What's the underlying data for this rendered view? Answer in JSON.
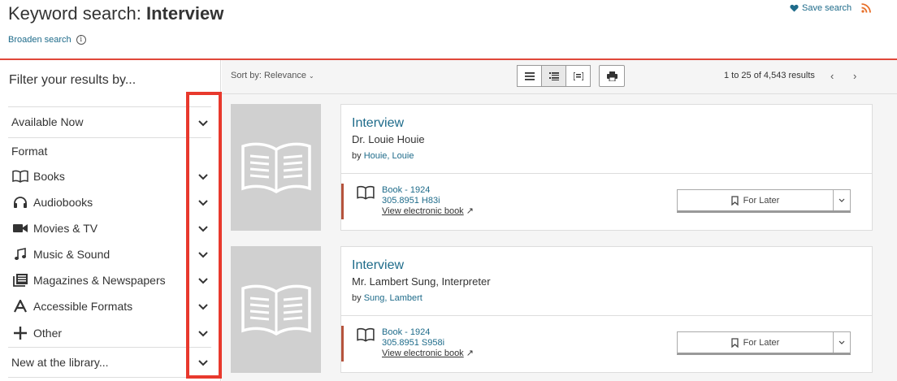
{
  "header": {
    "title_prefix": "Keyword search: ",
    "query": "Interview",
    "broaden": "Broaden search",
    "info_glyph": "i",
    "save_search": "Save search"
  },
  "sidebar": {
    "filter_title": "Filter your results by...",
    "available_now": "Available Now",
    "format_heading": "Format",
    "formats": [
      {
        "label": "Books",
        "icon": "book-icon"
      },
      {
        "label": "Audiobooks",
        "icon": "headphones-icon"
      },
      {
        "label": "Movies & TV",
        "icon": "video-camera-icon"
      },
      {
        "label": "Music & Sound",
        "icon": "music-note-icon"
      },
      {
        "label": "Magazines & Newspapers",
        "icon": "magazine-icon"
      },
      {
        "label": "Accessible Formats",
        "icon": "letter-a-icon"
      },
      {
        "label": "Other",
        "icon": "plus-icon"
      }
    ],
    "new_at_library": "New at the library..."
  },
  "toolbar": {
    "sort_label": "Sort by: Relevance",
    "results_text": "1 to 25 of 4,543 results"
  },
  "results": [
    {
      "title": "Interview",
      "subtitle": "Dr. Louie Houie",
      "by_prefix": "by ",
      "author": "Houie, Louie",
      "format": "Book - 1924",
      "call_number": "305.8951 H83i",
      "ebook_link": "View electronic book",
      "for_later": "For Later"
    },
    {
      "title": "Interview",
      "subtitle": "Mr. Lambert Sung, Interpreter",
      "by_prefix": "by ",
      "author": "Sung, Lambert",
      "format": "Book - 1924",
      "call_number": "305.8951 S958i",
      "ebook_link": "View electronic book",
      "for_later": "For Later"
    }
  ],
  "colors": {
    "accent_red": "#e0483a",
    "link_blue": "#1e6b8a",
    "availability_bar": "#b5533c",
    "highlight_box": "#e8392d"
  }
}
